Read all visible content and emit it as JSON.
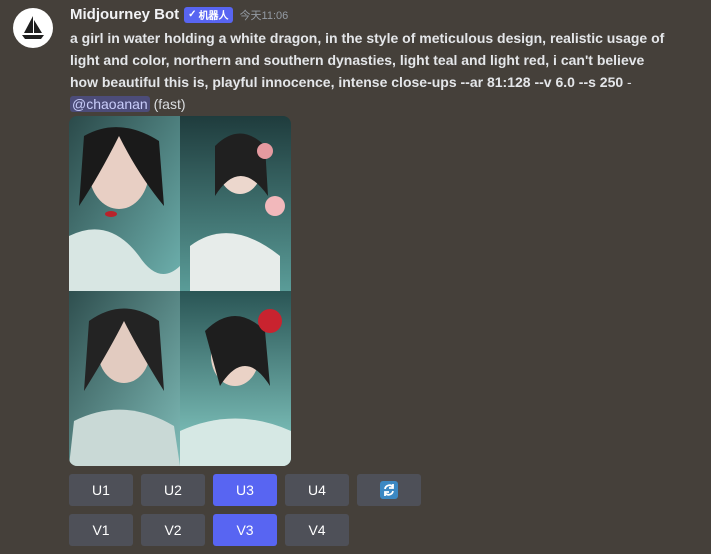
{
  "author": {
    "name": "Midjourney Bot",
    "bot_tag": "机器人",
    "timestamp": "今天11:06"
  },
  "message": {
    "prompt": "a girl in water holding a white dragon, in the style of meticulous design, realistic usage of light and color, northern and southern dynasties, light teal and light red, i can't believe how beautiful this is, playful innocence, intense close-ups --ar 81:128 --v 6.0 --s 250",
    "separator": " - ",
    "mention": "@chaoanan",
    "mode": " (fast)"
  },
  "image_grid": {
    "tiles": [
      "upper-left portrait",
      "upper-right portrait",
      "lower-left portrait",
      "lower-right portrait"
    ]
  },
  "buttons": {
    "upscale": [
      {
        "label": "U1",
        "active": false
      },
      {
        "label": "U2",
        "active": false
      },
      {
        "label": "U3",
        "active": true
      },
      {
        "label": "U4",
        "active": false
      }
    ],
    "reroll_icon": "refresh-icon",
    "variation": [
      {
        "label": "V1",
        "active": false
      },
      {
        "label": "V2",
        "active": false
      },
      {
        "label": "V3",
        "active": true
      },
      {
        "label": "V4",
        "active": false
      }
    ]
  },
  "colors": {
    "background": "#45403a",
    "button": "#4e5058",
    "button_active": "#5865f2",
    "bot_tag": "#5865f2",
    "mention_text": "#c9cdfb"
  }
}
